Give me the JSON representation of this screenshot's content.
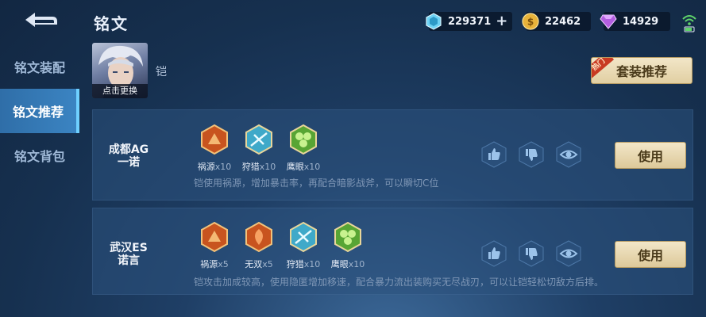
{
  "header": {
    "title": "铭文",
    "currencies": [
      {
        "name": "gem",
        "icon": "blue-gem-icon",
        "value": "229371",
        "add_label": "+"
      },
      {
        "name": "coin",
        "icon": "gold-coin-icon",
        "value": "22462"
      },
      {
        "name": "diamond",
        "icon": "purple-diamond-icon",
        "value": "14929"
      }
    ]
  },
  "sidebar": {
    "items": [
      {
        "label": "铭文装配",
        "active": false
      },
      {
        "label": "铭文推荐",
        "active": true
      },
      {
        "label": "铭文背包",
        "active": false
      }
    ]
  },
  "hero": {
    "caption": "点击更换",
    "name": "铠"
  },
  "suit_button": {
    "label": "套装推荐",
    "tag": "热门"
  },
  "recommendations": [
    {
      "author_line1": "成都AG",
      "author_line2": "一诺",
      "runes": [
        {
          "name": "祸源",
          "count": "x10",
          "color": "#c8541f",
          "icon": "red-rune-icon"
        },
        {
          "name": "狩猎",
          "count": "x10",
          "color": "#3fa9c9",
          "icon": "blue-rune-icon"
        },
        {
          "name": "鹰眼",
          "count": "x10",
          "color": "#58a534",
          "icon": "green-rune-icon"
        }
      ],
      "description": "铠使用祸源，增加暴击率，再配合暗影战斧，可以瞬切C位",
      "use_label": "使用"
    },
    {
      "author_line1": "武汉ES",
      "author_line2": "诺言",
      "runes": [
        {
          "name": "祸源",
          "count": "x5",
          "color": "#c8541f",
          "icon": "red-rune-icon"
        },
        {
          "name": "无双",
          "count": "x5",
          "color": "#c8541f",
          "icon": "red-rune-icon"
        },
        {
          "name": "狩猎",
          "count": "x10",
          "color": "#3fa9c9",
          "icon": "blue-rune-icon"
        },
        {
          "name": "鹰眼",
          "count": "x10",
          "color": "#58a534",
          "icon": "green-rune-icon"
        }
      ],
      "description": "铠攻击加成较高，使用隐匿增加移速，配合暴力流出装购买无尽战刃，可以让铠轻松切敌方后排。",
      "use_label": "使用"
    }
  ],
  "colors": {
    "accent": "#3b84c2",
    "button_gold": "#e1cfa2",
    "background": "#1f3f66"
  }
}
